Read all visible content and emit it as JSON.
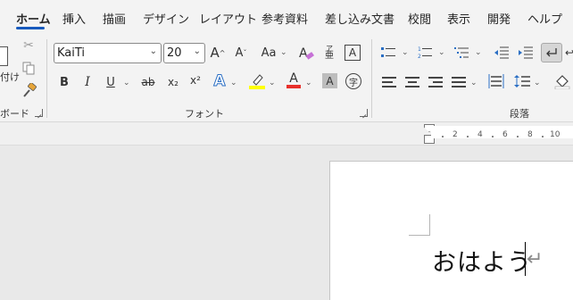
{
  "tabs": [
    "ホーム",
    "挿入",
    "描画",
    "デザイン",
    "レイアウト",
    "参考資料",
    "差し込み文書",
    "校閲",
    "表示",
    "開発",
    "ヘルプ"
  ],
  "clipboard": {
    "paste_label": "付け",
    "group_label": "ボード"
  },
  "font": {
    "name": "KaiTi",
    "size": "20",
    "group_label": "フォント",
    "grow_label": "A",
    "shrink_label": "A",
    "case_label": "Aa",
    "char_border_label": "A",
    "bold_label": "B",
    "italic_label": "I",
    "underline_label": "U",
    "strike_label": "ab",
    "subscript_label": "x₂",
    "superscript_label": "x²",
    "effects_label": "A",
    "font_color_label": "A",
    "shading_label": "A",
    "enclose_label": "字",
    "phonetic_label": "ア"
  },
  "paragraph": {
    "group_label": "段落"
  },
  "ruler": {
    "numbers": [
      "2",
      "4",
      "6",
      "8",
      "10"
    ]
  },
  "document": {
    "text": "おはよう",
    "paragraph_mark": "↵"
  },
  "colors": {
    "accent": "#185abd",
    "highlight": "#ffff00",
    "font_color": "#e8302b"
  }
}
